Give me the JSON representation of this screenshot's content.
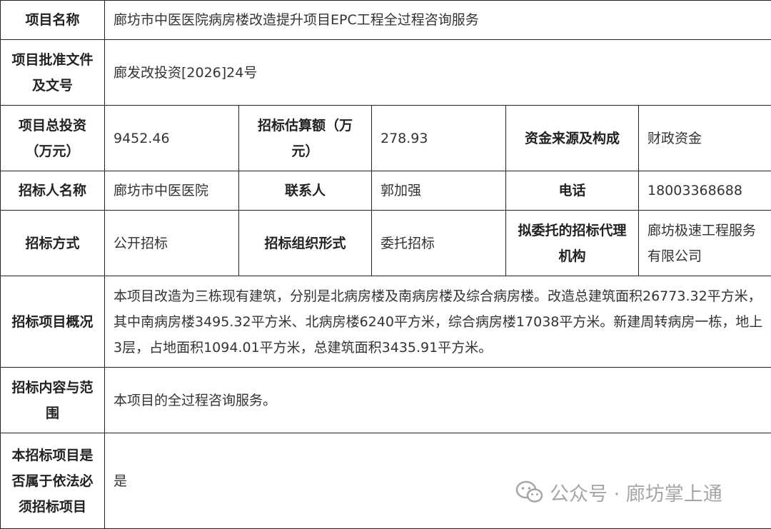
{
  "table": {
    "row1": {
      "label": "项目名称",
      "value": "廊坊市中医医院病房楼改造提升项目EPC工程全过程咨询服务"
    },
    "row2": {
      "label_line1": "项目批准文件",
      "label_line2": "及文号",
      "value": "廊发改投资[2026]24号"
    },
    "row3": {
      "label1_line1": "项目总投资",
      "label1_line2": "（万元）",
      "value1": "9452.46",
      "label2_line1": "招标估算额（万",
      "label2_line2": "元）",
      "value2": "278.93",
      "label3": "资金来源及构成",
      "value3": "财政资金"
    },
    "row4": {
      "label1": "招标人名称",
      "value1": "廊坊市中医医院",
      "label2": "联系人",
      "value2": "郭加强",
      "label3": "电话",
      "value3": "18003368688"
    },
    "row5": {
      "label1": "招标方式",
      "value1": "公开招标",
      "label2": "招标组织形式",
      "value2": "委托招标",
      "label3_line1": "拟委托的招标代理",
      "label3_line2": "机构",
      "value3_line1": "廊坊极速工程服务",
      "value3_line2": "有限公司"
    },
    "row6": {
      "label": "招标项目概况",
      "value": "本项目改造为三栋现有建筑，分别是北病房楼及南病房楼及综合病房楼。改造总建筑面积26773.32平方米，其中南病房楼3495.32平方米、北病房楼6240平方米，综合病房楼17038平方米。新建周转病房一栋，地上3层，占地面积1094.01平方米，总建筑面积3435.91平方米。"
    },
    "row7": {
      "label_line1": "招标内容与范",
      "label_line2": "围",
      "value": "本项目的全过程咨询服务。"
    },
    "row8": {
      "label_line1": "本招标项目是",
      "label_line2": "否属于依法必",
      "label_line3": "须招标项目",
      "value": "是"
    }
  },
  "watermark": {
    "text": "公众号 · 廊坊掌上通",
    "icon": "wechat-icon"
  }
}
